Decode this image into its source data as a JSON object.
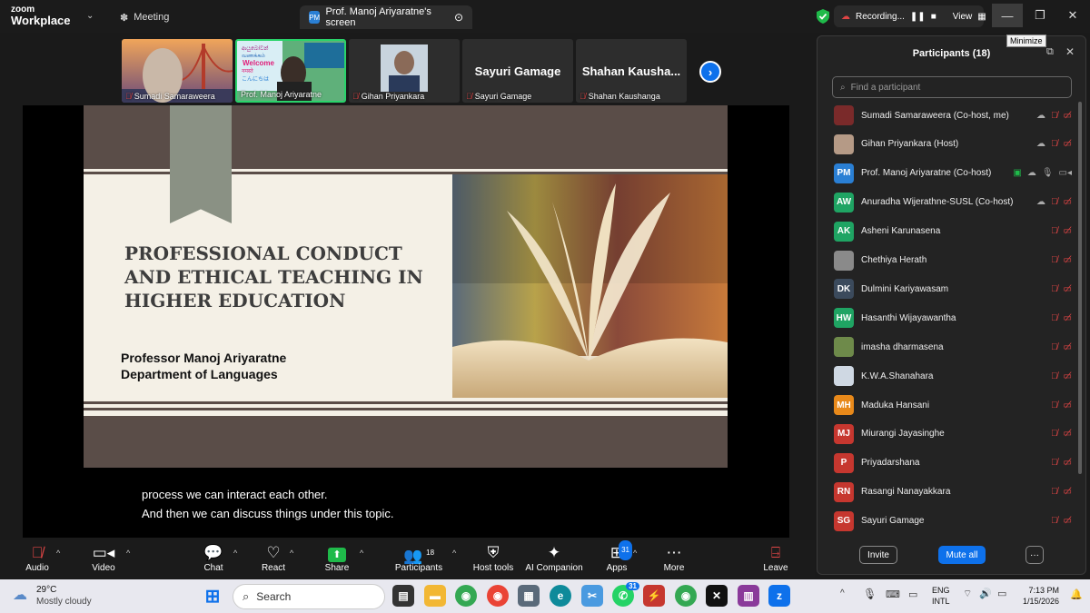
{
  "app": {
    "brand_top": "zoom",
    "brand_bottom": "Workplace"
  },
  "tabs": {
    "meeting": "Meeting",
    "screen": "Prof. Manoj Ariyaratne's screen",
    "screen_chip": "PM"
  },
  "recording": {
    "label": "Recording...",
    "view": "View"
  },
  "window": {
    "minimize_tooltip": "Minimize"
  },
  "gallery": [
    {
      "name": "Sumadi Samaraweera"
    },
    {
      "name": "Prof. Manoj Ariyaratne"
    },
    {
      "name": "Gihan Priyankara"
    },
    {
      "name": "Sayuri Gamage",
      "big": "Sayuri Gamage"
    },
    {
      "name": "Shahan Kaushanga",
      "big": "Shahan  Kausha..."
    }
  ],
  "tile_banner": {
    "welcome": "Welcome"
  },
  "slide": {
    "title": "PROFESSIONAL CONDUCT AND ETHICAL TEACHING IN HIGHER EDUCATION",
    "author_line1": "Professor Manoj Ariyaratne",
    "author_line2": "Department of Languages"
  },
  "captions": {
    "line1": "process we can interact each other.",
    "line2": "And then we can discuss things under this topic."
  },
  "toolbar": {
    "audio": "Audio",
    "video": "Video",
    "chat": "Chat",
    "react": "React",
    "share": "Share",
    "participants": "Participants",
    "participants_count": "18",
    "host_tools": "Host tools",
    "ai_companion": "AI Companion",
    "apps": "Apps",
    "apps_badge": "31",
    "more": "More",
    "leave": "Leave"
  },
  "panel": {
    "title": "Participants (18)",
    "search_placeholder": "Find a participant",
    "invite": "Invite",
    "mute_all": "Mute all",
    "more": "···",
    "participants": [
      {
        "name": "Sumadi Samaraweera (Co-host, me)",
        "initials": "",
        "color": "#7a2a2a"
      },
      {
        "name": "Gihan Priyankara (Host)",
        "initials": "",
        "color": "#b59a86"
      },
      {
        "name": "Prof. Manoj Ariyaratne (Co-host)",
        "initials": "PM",
        "color": "#2a7fd4"
      },
      {
        "name": "Anuradha Wijerathne-SUSL (Co-host)",
        "initials": "AW",
        "color": "#1fa463"
      },
      {
        "name": "Asheni Karunasena",
        "initials": "AK",
        "color": "#1fa463"
      },
      {
        "name": "Chethiya Herath",
        "initials": "",
        "color": "#8a8a8a"
      },
      {
        "name": "Dulmini Kariyawasam",
        "initials": "DK",
        "color": "#3b4a5c"
      },
      {
        "name": "Hasanthi Wijayawantha",
        "initials": "HW",
        "color": "#1fa463"
      },
      {
        "name": "imasha dharmasena",
        "initials": "",
        "color": "#6e8a4a"
      },
      {
        "name": "K.W.A.Shanahara",
        "initials": "",
        "color": "#cfd8e3"
      },
      {
        "name": "Maduka Hansani",
        "initials": "MH",
        "color": "#e8891a"
      },
      {
        "name": "Miurangi Jayasinghe",
        "initials": "MJ",
        "color": "#c6372f"
      },
      {
        "name": "Priyadarshana",
        "initials": "P",
        "color": "#c6372f"
      },
      {
        "name": "Rasangi Nanayakkara",
        "initials": "RN",
        "color": "#c6372f"
      },
      {
        "name": "Sayuri Gamage",
        "initials": "SG",
        "color": "#c6372f"
      }
    ]
  },
  "taskbar": {
    "temp": "29°C",
    "weather": "Mostly cloudy",
    "search": "Search",
    "whatsapp_badge": "31",
    "lang1": "ENG",
    "lang2": "INTL",
    "time": "7:13 PM",
    "date": "1/15/2026"
  }
}
